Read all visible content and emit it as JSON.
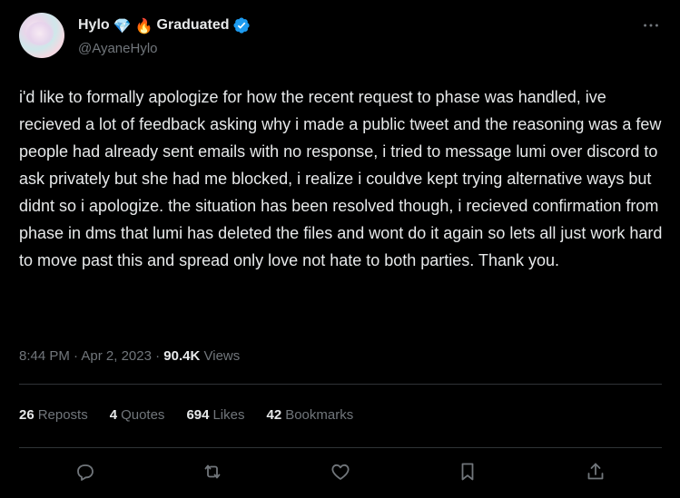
{
  "author": {
    "display_name": "Hylo",
    "gem_emoji": "💎",
    "fire_emoji": "🔥",
    "name_suffix": "Graduated",
    "handle": "@AyaneHylo",
    "verified_color": "#1d9bf0"
  },
  "header": {
    "more_icon": "more-horizontal-icon"
  },
  "tweet": {
    "text": "i'd like to formally apologize for how the recent request to phase was handled, ive recieved a lot of feedback asking why i made a public tweet and the reasoning was a few people had already sent emails with no response, i tried to message lumi over discord to ask privately but she had me blocked, i realize i couldve kept trying alternative ways but didnt so i apologize. the situation has been resolved though, i recieved confirmation from phase in dms that lumi has deleted the files and wont do it again so lets all just work hard to move past this and spread only love not hate to both parties. Thank you."
  },
  "meta": {
    "time": "8:44 PM",
    "separator": "·",
    "date": "Apr 2, 2023",
    "views_count": "90.4K",
    "views_label": "Views"
  },
  "stats": {
    "reposts": {
      "count": "26",
      "label": "Reposts"
    },
    "quotes": {
      "count": "4",
      "label": "Quotes"
    },
    "likes": {
      "count": "694",
      "label": "Likes"
    },
    "bookmarks": {
      "count": "42",
      "label": "Bookmarks"
    }
  },
  "actions": {
    "icons": [
      "reply-icon",
      "repost-icon",
      "like-icon",
      "bookmark-icon",
      "share-icon"
    ]
  },
  "colors": {
    "background": "#000000",
    "text": "#e7e9ea",
    "muted": "#71767b",
    "divider": "#2f3336",
    "accent": "#1d9bf0"
  }
}
